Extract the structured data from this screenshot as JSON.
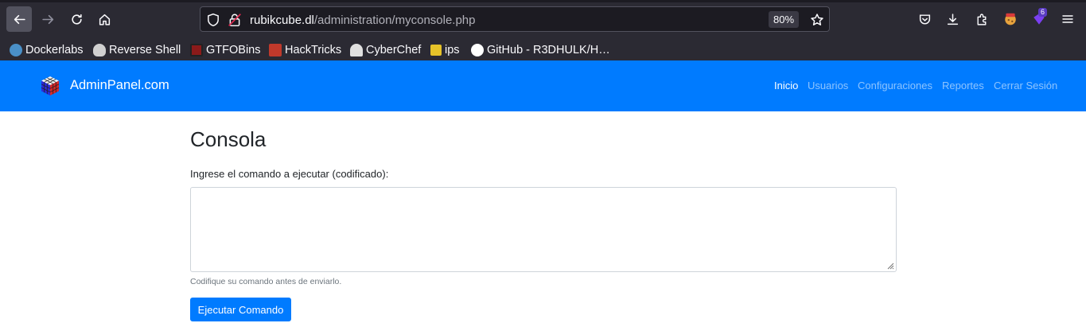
{
  "browser": {
    "url_host": "rubikcube.dl",
    "url_path": "/administration/myconsole.php",
    "zoom": "80%",
    "extension_badge": "6"
  },
  "bookmarks": [
    {
      "label": "Dockerlabs",
      "icon": "dockerlabs-icon",
      "color": "#4a90c8"
    },
    {
      "label": "Reverse Shell",
      "icon": "skull-icon",
      "color": "#d0d0d0"
    },
    {
      "label": "GTFOBins",
      "icon": "gtfobins-icon",
      "color": "#8b1a1a"
    },
    {
      "label": "HackTricks",
      "icon": "hacktricks-icon",
      "color": "#c0392b"
    },
    {
      "label": "CyberChef",
      "icon": "chef-hat-icon",
      "color": "#e0e0e0"
    },
    {
      "label": "ips",
      "icon": "ips-icon",
      "color": "#e6c229"
    },
    {
      "label": "GitHub - R3DHULK/H…",
      "icon": "github-icon",
      "color": "#ffffff"
    }
  ],
  "navbar": {
    "brand": "AdminPanel.com",
    "links": [
      "Inicio",
      "Usuarios",
      "Configuraciones",
      "Reportes",
      "Cerrar Sesión"
    ]
  },
  "page": {
    "title": "Consola",
    "label": "Ingrese el comando a ejecutar (codificado):",
    "textarea_value": "",
    "help": "Codifique su comando antes de enviarlo.",
    "submit": "Ejecutar Comando"
  },
  "colors": {
    "primary": "#007bff",
    "toolbar": "#2b2a33"
  }
}
